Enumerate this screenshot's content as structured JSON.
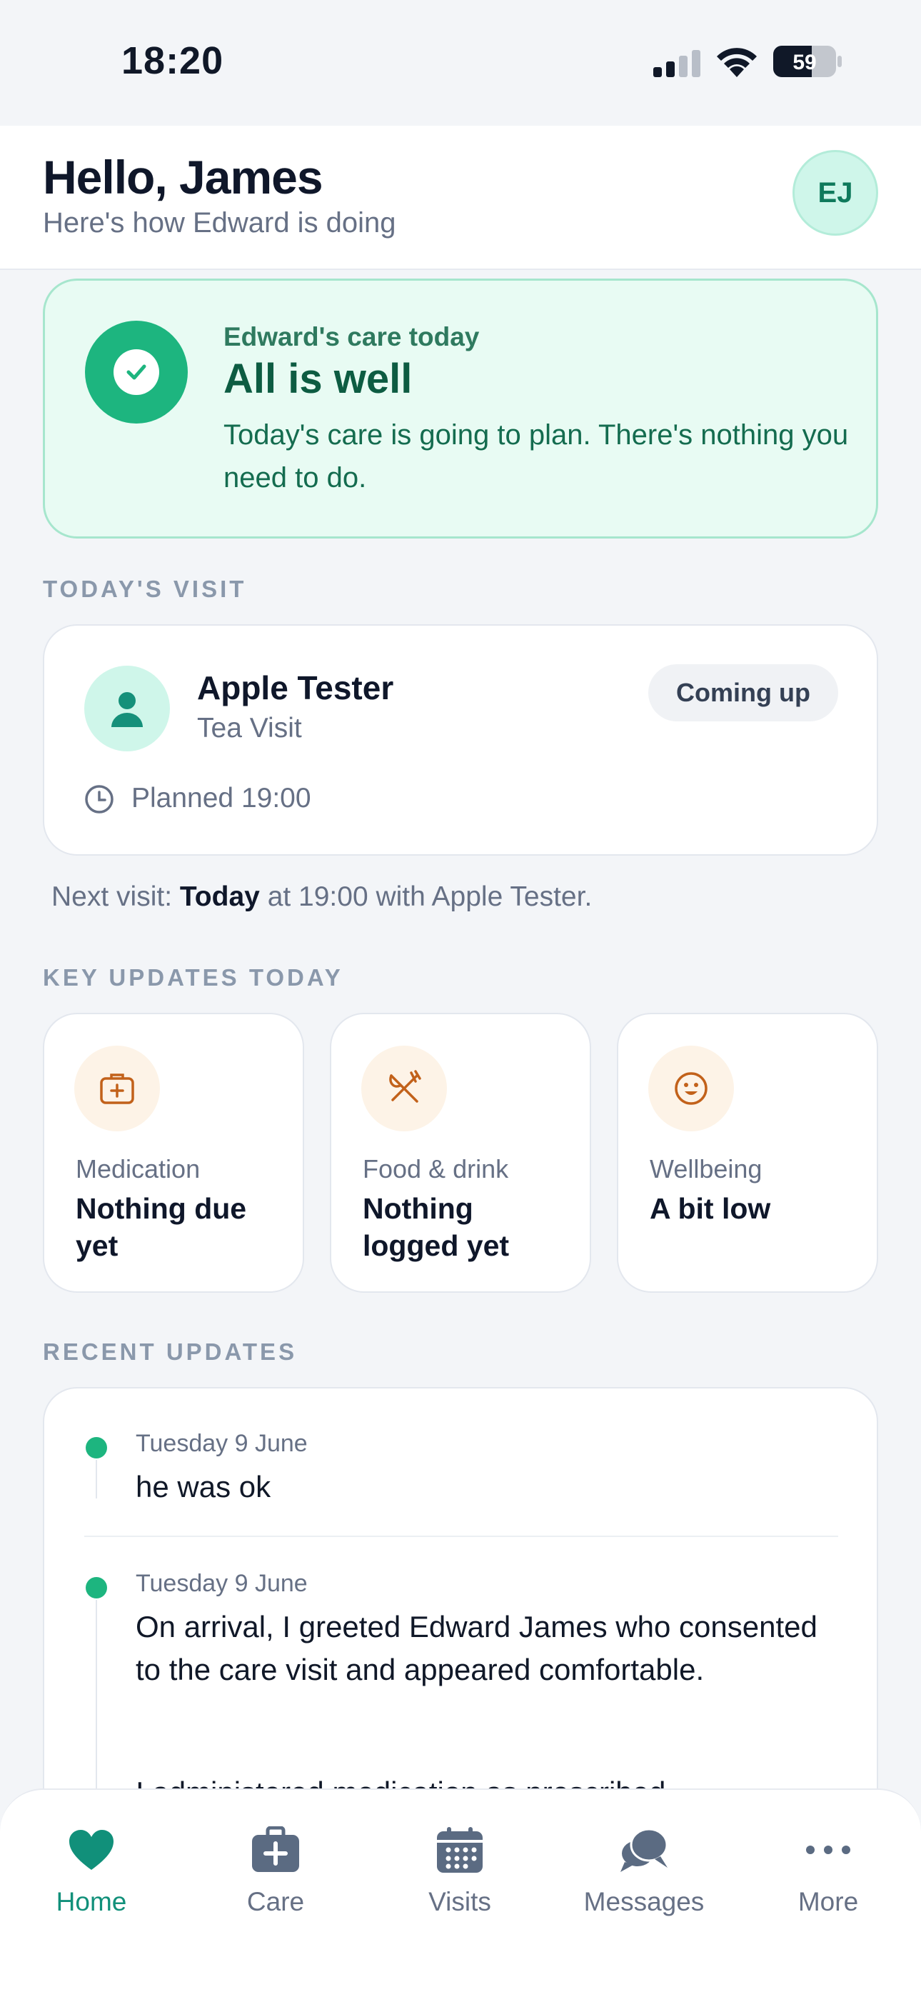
{
  "status_bar": {
    "time": "18:20",
    "battery": "59"
  },
  "header": {
    "greeting": "Hello, James",
    "subtitle": "Here's how Edward is doing",
    "avatar_initials": "EJ"
  },
  "status_card": {
    "kicker": "Edward's care today",
    "title": "All is well",
    "message": "Today's care is going to plan. There's nothing you need to do."
  },
  "todays_visit": {
    "section_label": "TODAY'S VISIT",
    "carer_name": "Apple Tester",
    "visit_type": "Tea Visit",
    "badge": "Coming up",
    "planned": "Planned 19:00"
  },
  "next_visit": {
    "prefix": "Next visit:",
    "day": "Today",
    "suffix": "at 19:00 with Apple Tester."
  },
  "key_updates": {
    "section_label": "KEY UPDATES TODAY",
    "items": [
      {
        "icon": "medical-bag-icon",
        "label": "Medication",
        "value": "Nothing due yet"
      },
      {
        "icon": "fork-knife-icon",
        "label": "Food & drink",
        "value": "Nothing logged yet"
      },
      {
        "icon": "smiley-face-icon",
        "label": "Wellbeing",
        "value": "A bit low"
      }
    ]
  },
  "recent_updates": {
    "section_label": "RECENT UPDATES",
    "items": [
      {
        "date": "Tuesday 9 June",
        "text": "he was ok"
      },
      {
        "date": "Tuesday 9 June",
        "text": "On arrival, I greeted Edward James who consented to the care visit and appeared comfortable.",
        "text_more": "I administered medication as prescribed"
      }
    ]
  },
  "tab_bar": {
    "tabs": [
      {
        "label": "Home",
        "icon": "heart-icon",
        "active": true
      },
      {
        "label": "Care",
        "icon": "medical-bag-icon",
        "active": false
      },
      {
        "label": "Visits",
        "icon": "calendar-icon",
        "active": false
      },
      {
        "label": "Messages",
        "icon": "chat-bubbles-icon",
        "active": false
      },
      {
        "label": "More",
        "icon": "more-dots-icon",
        "active": false
      }
    ]
  },
  "colors": {
    "accent": "#11907a",
    "success": "#1db57f",
    "warm": "#c2611a",
    "muted": "#667085"
  }
}
